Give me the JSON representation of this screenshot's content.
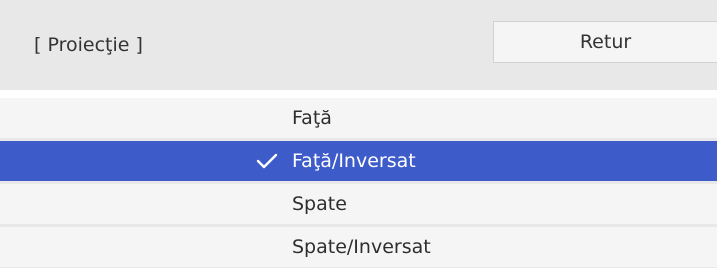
{
  "header": {
    "title": "[ Proiecţie ]",
    "back_label": "Retur"
  },
  "options": [
    {
      "label": "Faţă",
      "selected": false
    },
    {
      "label": "Faţă/Inversat",
      "selected": true,
      "icon": "checkmark-icon"
    },
    {
      "label": "Spate",
      "selected": false
    },
    {
      "label": "Spate/Inversat",
      "selected": false
    }
  ],
  "colors": {
    "selection": "#3d5bc9",
    "panel": "#e8e8e8",
    "row": "#f5f5f5"
  }
}
